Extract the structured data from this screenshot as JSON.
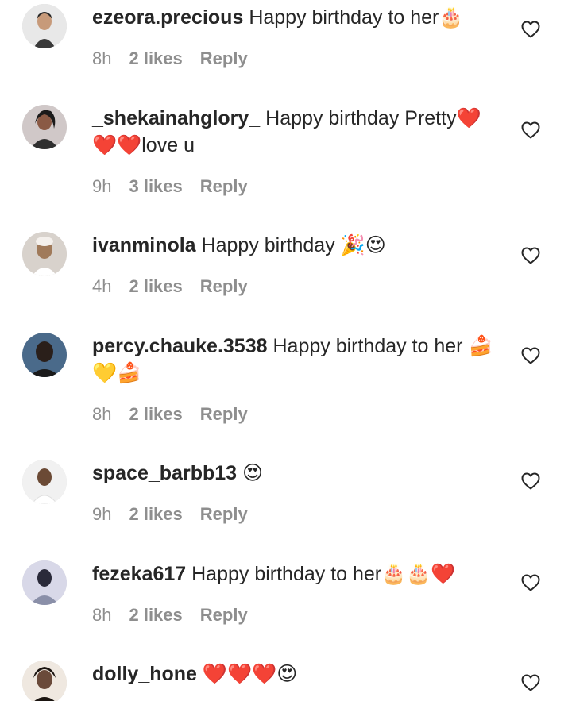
{
  "comments": [
    {
      "username": "ezeora.precious",
      "text": "Happy birthday to her🎂",
      "time": "8h",
      "likes": "2 likes",
      "reply": "Reply",
      "avatar_colors": [
        "#e8e8e8",
        "#3a3a3a",
        "#c79a7a"
      ]
    },
    {
      "username": "_shekainahglory_",
      "text": "Happy birthday Pretty❤️❤️❤️love u",
      "time": "9h",
      "likes": "3 likes",
      "reply": "Reply",
      "avatar_colors": [
        "#2f2f2f",
        "#8a5a45",
        "#d0c8c8"
      ]
    },
    {
      "username": "ivanminola",
      "text": "Happy birthday 🎉😍",
      "time": "4h",
      "likes": "2 likes",
      "reply": "Reply",
      "avatar_colors": [
        "#d8d2cc",
        "#a07a5a",
        "#ffffff"
      ]
    },
    {
      "username": "percy.chauke.3538",
      "text": "Happy birthday to her 🍰💛🍰",
      "time": "8h",
      "likes": "2 likes",
      "reply": "Reply",
      "avatar_colors": [
        "#4a6a8a",
        "#2a1f1a",
        "#1a1a1a"
      ]
    },
    {
      "username": "space_barbb13",
      "text": "😍",
      "time": "9h",
      "likes": "2 likes",
      "reply": "Reply",
      "avatar_colors": [
        "#f1f1f1",
        "#6b4a35",
        "#ffffff"
      ]
    },
    {
      "username": "fezeka617",
      "text": "Happy birthday to her🎂🎂❤️",
      "time": "8h",
      "likes": "2 likes",
      "reply": "Reply",
      "avatar_colors": [
        "#8a8fa8",
        "#2a2a3a",
        "#d8d8e8"
      ]
    },
    {
      "username": "dolly_hone",
      "text": "❤️❤️❤️😍",
      "time": "",
      "likes": "",
      "reply": "",
      "avatar_colors": [
        "#efe8e0",
        "#1a1410",
        "#6a4a3a"
      ]
    }
  ],
  "heart_icon_color": "#262626",
  "meta_color": "#8e8e8e"
}
